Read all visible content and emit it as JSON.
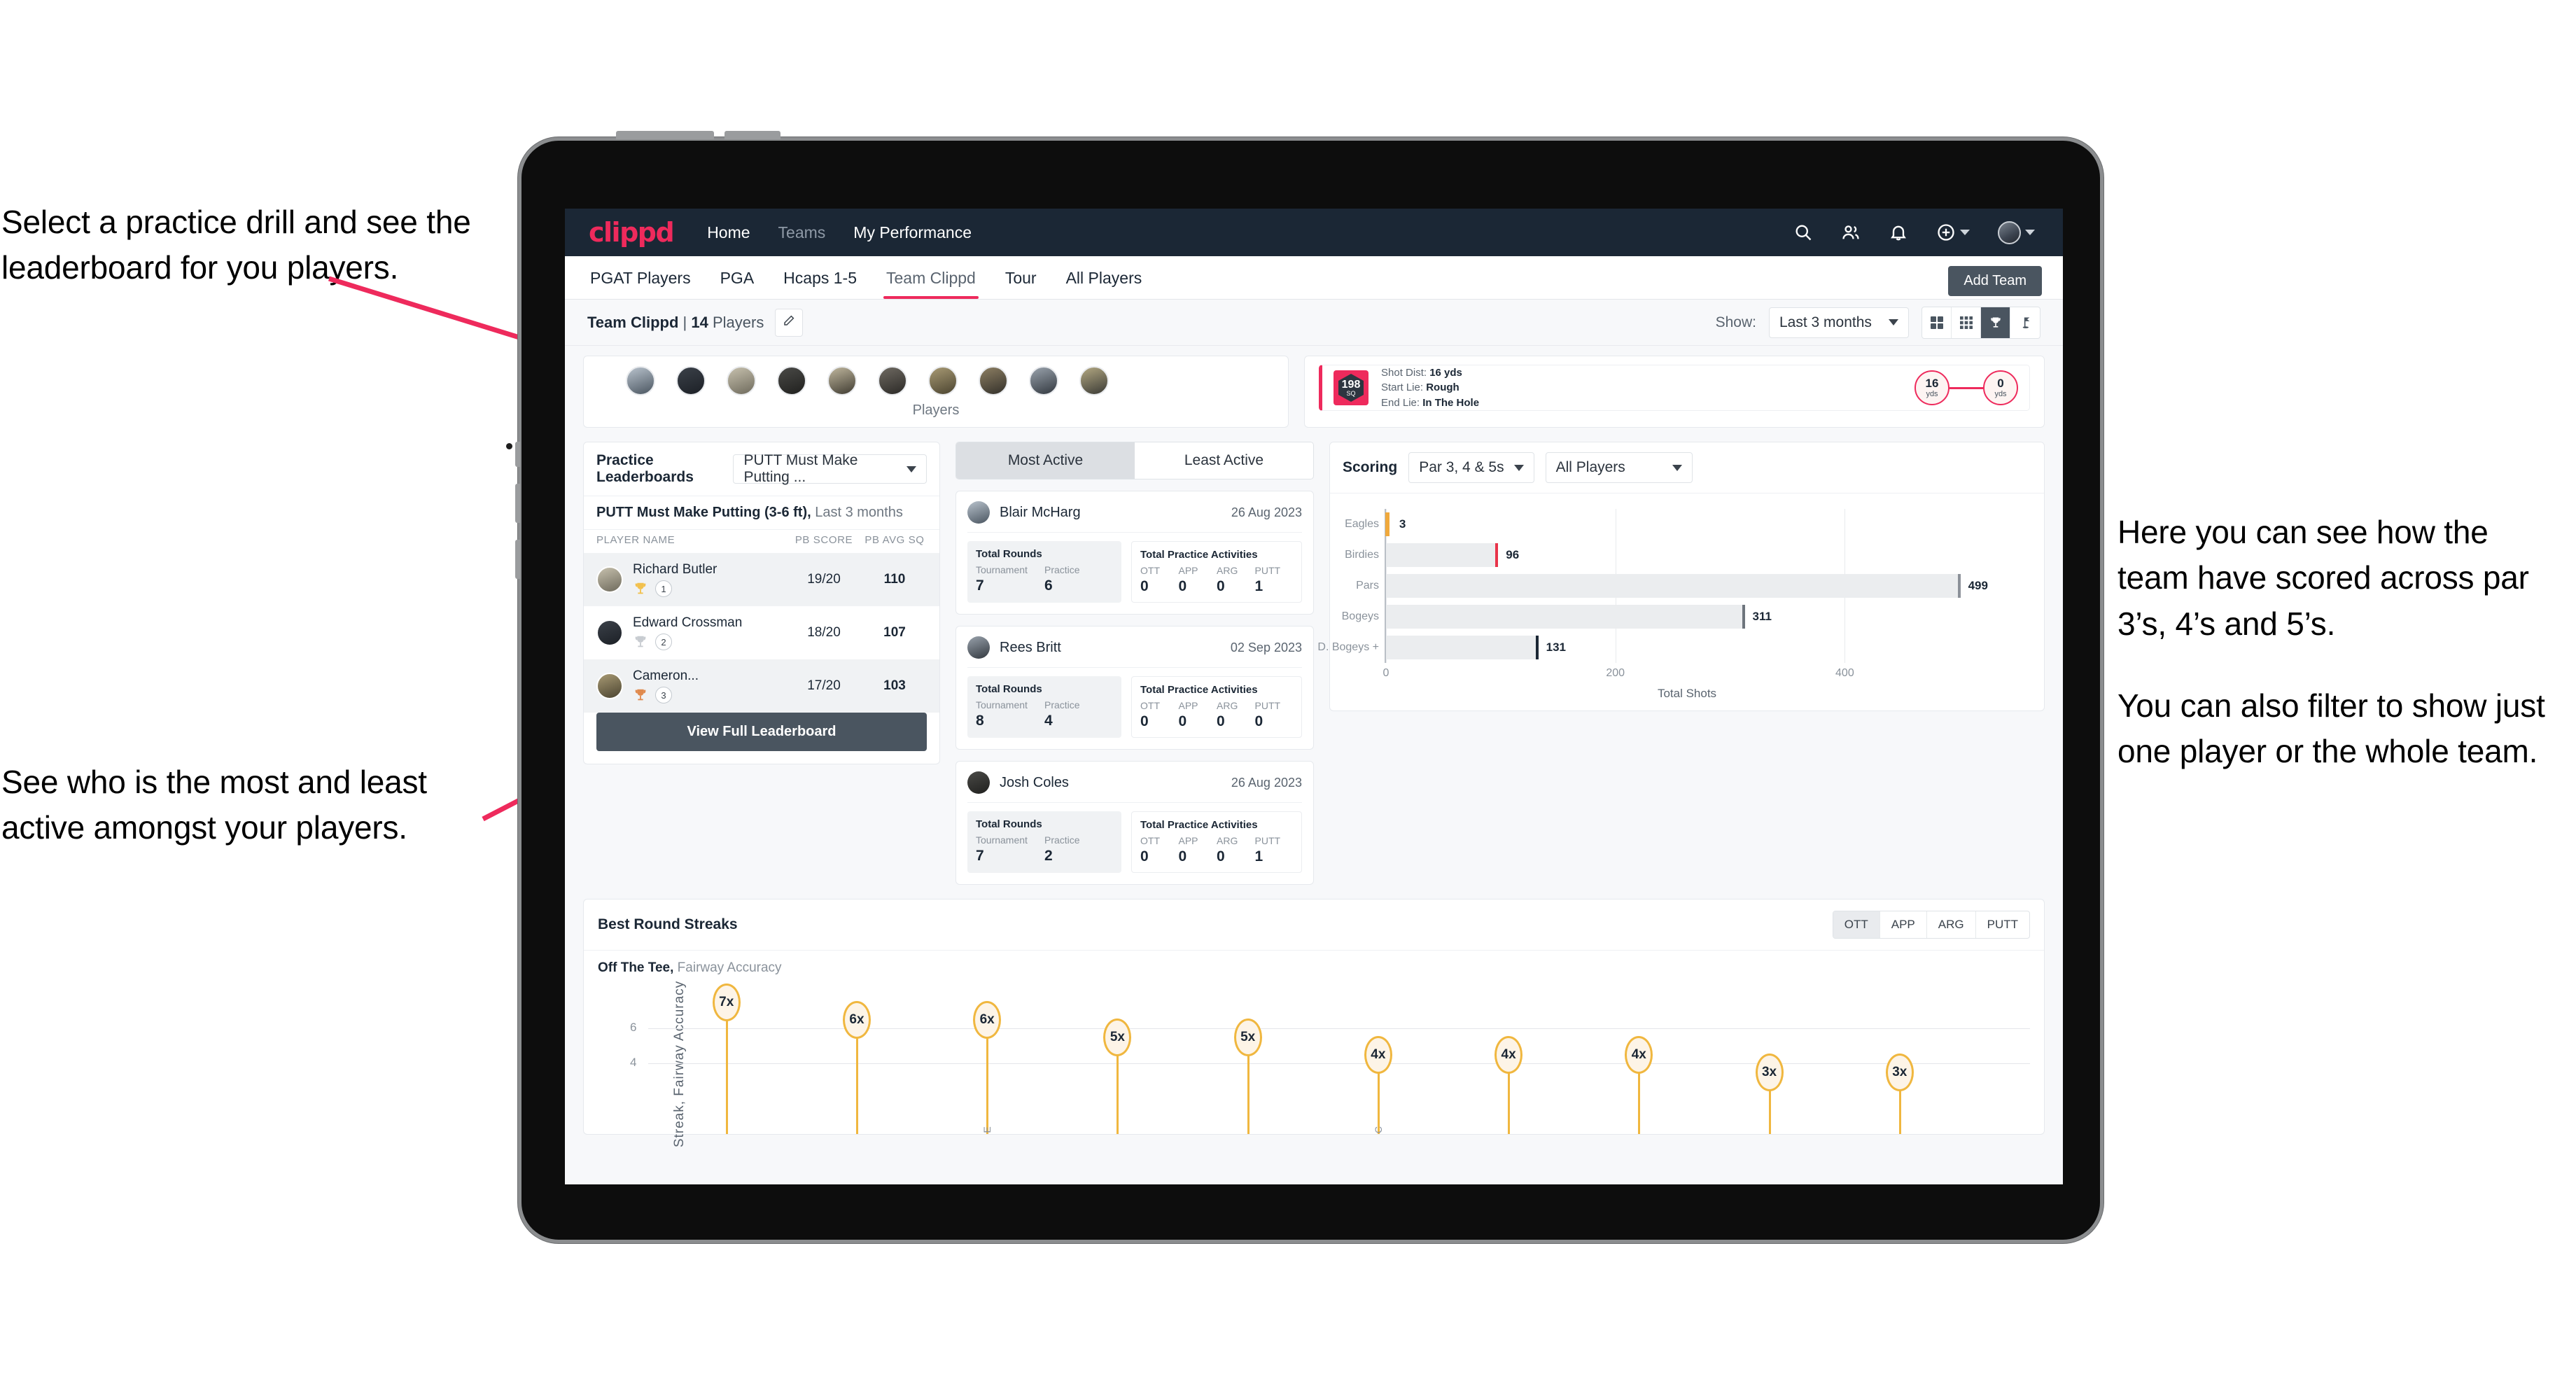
{
  "annotations": {
    "top_left": "Select a practice drill and see the leaderboard for you players.",
    "bottom_left": "See who is the most and least active amongst your players.",
    "right_1": "Here you can see how the team have scored across par 3’s, 4’s and 5’s.",
    "right_2": "You can also filter to show just one player or the whole team."
  },
  "navbar": {
    "logo": "clippd",
    "links": [
      {
        "label": "Home",
        "muted": false
      },
      {
        "label": "Teams",
        "muted": true
      },
      {
        "label": "My Performance",
        "muted": false
      }
    ],
    "icons": [
      "search-icon",
      "people-icon",
      "bell-icon",
      "plus-circle-icon",
      "avatar"
    ]
  },
  "tabs": {
    "items": [
      "PGAT Players",
      "PGA",
      "Hcaps 1-5",
      "Team Clippd",
      "Tour",
      "All Players"
    ],
    "active": "Team Clippd",
    "add_team_label": "Add Team"
  },
  "subheader": {
    "team_name": "Team Clippd",
    "separator": "|",
    "player_count": "14",
    "players_word": "Players",
    "edit_icon": "pencil-icon",
    "show_label": "Show:",
    "range_value": "Last 3 months",
    "view_icons": [
      "grid-large-icon",
      "grid-small-icon",
      "trophy-icon",
      "flag-icon"
    ],
    "active_view": "trophy-icon"
  },
  "players_strip": {
    "caption": "Players",
    "avatar_count": 10
  },
  "shot_card": {
    "score": "198",
    "score_unit": "SQ",
    "shot_dist_label": "Shot Dist:",
    "shot_dist_value": "16 yds",
    "start_lie_label": "Start Lie:",
    "start_lie_value": "Rough",
    "end_lie_label": "End Lie:",
    "end_lie_value": "In The Hole",
    "from_value": "16",
    "from_unit": "yds",
    "to_value": "0",
    "to_unit": "yds"
  },
  "leaderboard": {
    "title": "Practice Leaderboards",
    "drill_select": "PUTT Must Make Putting ...",
    "subtitle_bold": "PUTT Must Make Putting (3-6 ft),",
    "subtitle_light": "Last 3 months",
    "columns": [
      "PLAYER NAME",
      "PB SCORE",
      "PB AVG SQ"
    ],
    "rows": [
      {
        "name": "Richard Butler",
        "rank": "1",
        "medal": "gold",
        "score": "19/20",
        "avg_sq": "110"
      },
      {
        "name": "Edward Crossman",
        "rank": "2",
        "medal": "silver",
        "score": "18/20",
        "avg_sq": "107"
      },
      {
        "name": "Cameron...",
        "rank": "3",
        "medal": "bronze",
        "score": "17/20",
        "avg_sq": "103"
      }
    ],
    "button_label": "View Full Leaderboard"
  },
  "activity": {
    "tabs": [
      "Most Active",
      "Least Active"
    ],
    "active_tab": "Most Active",
    "rounds_title": "Total Rounds",
    "practice_title": "Total Practice Activities",
    "rounds_keys": [
      "Tournament",
      "Practice"
    ],
    "practice_keys": [
      "OTT",
      "APP",
      "ARG",
      "PUTT"
    ],
    "items": [
      {
        "name": "Blair McHarg",
        "date": "26 Aug 2023",
        "tournament": "7",
        "practice": "6",
        "ott": "0",
        "app": "0",
        "arg": "0",
        "putt": "1"
      },
      {
        "name": "Rees Britt",
        "date": "02 Sep 2023",
        "tournament": "8",
        "practice": "4",
        "ott": "0",
        "app": "0",
        "arg": "0",
        "putt": "0"
      },
      {
        "name": "Josh Coles",
        "date": "26 Aug 2023",
        "tournament": "7",
        "practice": "2",
        "ott": "0",
        "app": "0",
        "arg": "0",
        "putt": "1"
      }
    ]
  },
  "scoring": {
    "title": "Scoring",
    "par_filter": "Par 3, 4 & 5s",
    "player_filter": "All Players"
  },
  "streaks": {
    "title": "Best Round Streaks",
    "toggle": [
      "OTT",
      "APP",
      "ARG",
      "PUTT"
    ],
    "active_toggle": "OTT",
    "sub_bold": "Off The Tee,",
    "sub_light": "Fairway Accuracy"
  },
  "colors": {
    "brand_pink": "#ee2a5c",
    "nav_dark": "#1b2735",
    "button_slate": "#4a5560",
    "gold": "#f0b73f",
    "bar_grey": "#ebedef"
  },
  "chart_data": [
    {
      "type": "bar",
      "orientation": "horizontal",
      "title": "Scoring",
      "categories": [
        "Eagles",
        "Birdies",
        "Pars",
        "Bogeys",
        "D. Bogeys +"
      ],
      "values": [
        3,
        96,
        499,
        311,
        131
      ],
      "cap_colors": [
        "#f0a93c",
        "#e8344a",
        "#8c9199",
        "#6e757d",
        "#1b2735"
      ],
      "xlabel": "Total Shots",
      "ylabel": "",
      "xlim": [
        0,
        520
      ],
      "xticks": [
        0,
        200,
        400
      ],
      "grid": true,
      "legend": "none"
    },
    {
      "type": "lollipop",
      "title": "Best Round Streaks",
      "subtitle": "Off The Tee, Fairway Accuracy",
      "ylabel": "Streak, Fairway Accuracy",
      "yticks": [
        4,
        6
      ],
      "ylim": [
        0,
        8
      ],
      "categories": [
        "",
        "",
        "E",
        "",
        "",
        "C",
        "",
        "",
        "",
        ""
      ],
      "values": [
        7,
        6,
        6,
        5,
        5,
        4,
        4,
        4,
        3,
        3
      ],
      "labels": [
        "7x",
        "6x",
        "6x",
        "5x",
        "5x",
        "4x",
        "4x",
        "4x",
        "3x",
        "3x"
      ],
      "grid": true,
      "legend": "none"
    }
  ]
}
